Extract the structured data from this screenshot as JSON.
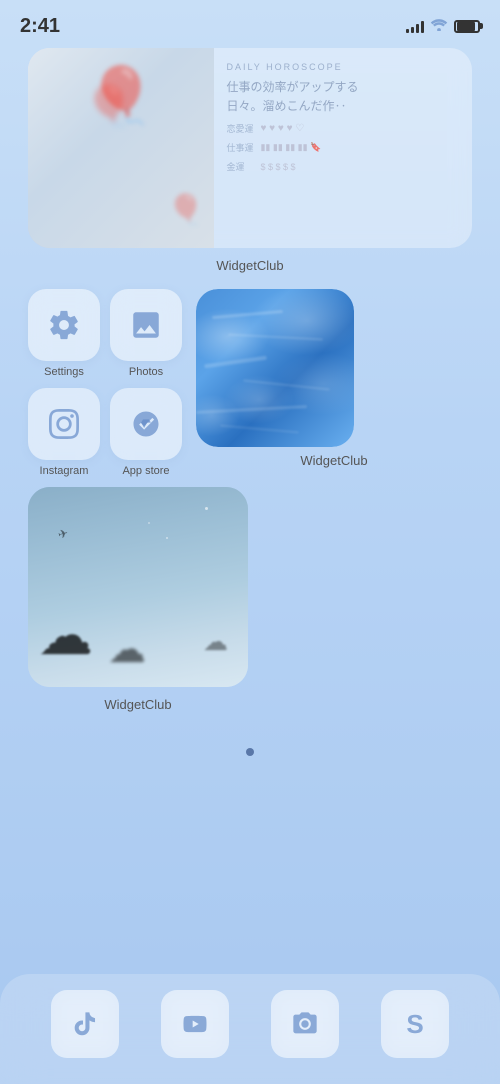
{
  "statusBar": {
    "time": "2:41",
    "signal": [
      3,
      5,
      8,
      11,
      13
    ],
    "battery": "full"
  },
  "widget1": {
    "label": "WidgetClub",
    "horoscope": {
      "title": "DAILY HOROSCOPE",
      "text": "仕事の効率がアップする\n日々。溜めこんだ作‥",
      "love_label": "恋愛運",
      "work_label": "仕事運",
      "money_label": "金運"
    }
  },
  "apps": {
    "settings": {
      "label": "Settings"
    },
    "photos": {
      "label": "Photos"
    },
    "instagram": {
      "label": "Instagram"
    },
    "appstore": {
      "label": "App store"
    }
  },
  "widget2": {
    "label": "WidgetClub"
  },
  "widget3": {
    "label": "WidgetClub"
  },
  "dock": {
    "tiktok": "tiktok",
    "youtube": "youtube",
    "camera": "camera",
    "shortcuts": "shortcuts"
  }
}
